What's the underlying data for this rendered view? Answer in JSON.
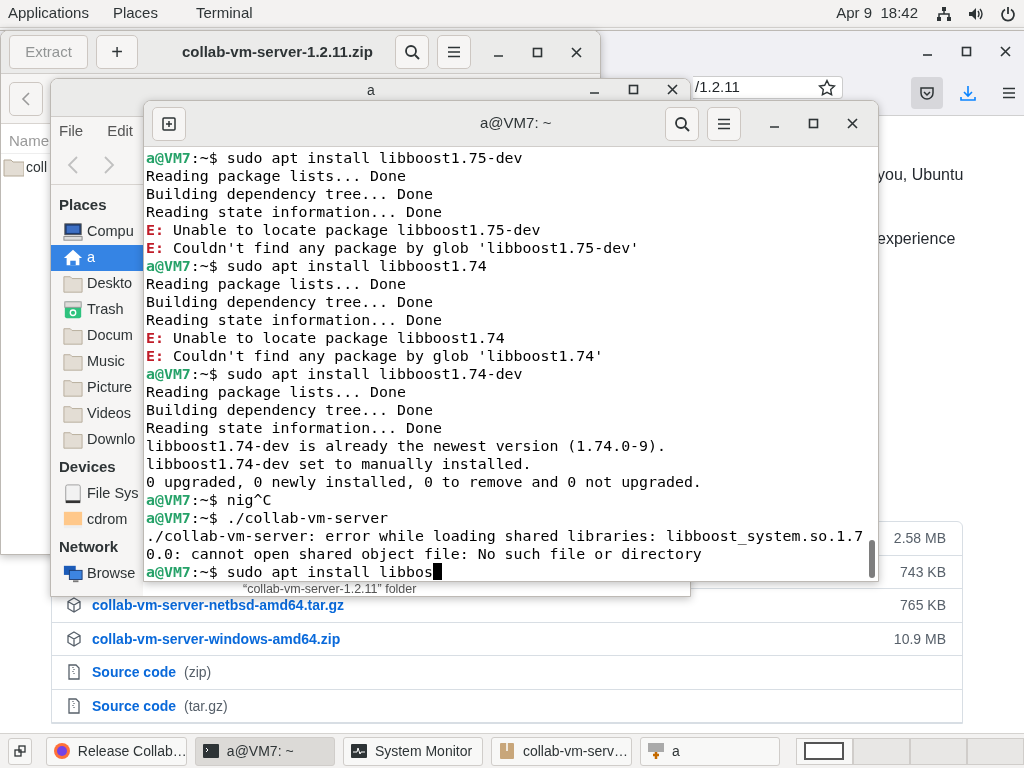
{
  "top_bar": {
    "menus": [
      "Applications",
      "Places",
      "Terminal"
    ],
    "clock": "Apr 9  18:42"
  },
  "browser": {
    "url": "/1.2.11",
    "text_lines": [
      "you, Ubuntu",
      "experience"
    ],
    "assets": [
      {
        "kind": "size_only",
        "size": "2.58 MB"
      },
      {
        "kind": "size_only",
        "size": "743 KB"
      },
      {
        "kind": "package",
        "name": "collab-vm-server-netbsd-amd64.tar.gz",
        "size": "765 KB"
      },
      {
        "kind": "package",
        "name": "collab-vm-server-windows-amd64.zip",
        "size": "10.9 MB"
      },
      {
        "kind": "source",
        "name": "Source code",
        "format": "(zip)"
      },
      {
        "kind": "source",
        "name": "Source code",
        "format": "(tar.gz)"
      }
    ]
  },
  "archive_window": {
    "extract_button": {
      "label": "Extract",
      "disabled": true
    },
    "add_button": "+",
    "title": "collab-vm-server-1.2.11.zip",
    "column": "Name",
    "rows": [
      "coll"
    ]
  },
  "file_manager": {
    "title": "a",
    "menus": [
      "File",
      "Edit"
    ],
    "sidebar": [
      {
        "heading": "Places",
        "items": [
          {
            "kind": "computer",
            "label": "Compu",
            "selected": false
          },
          {
            "kind": "home",
            "label": "a",
            "selected": true
          },
          {
            "kind": "folder",
            "label": "Deskto",
            "selected": false
          },
          {
            "kind": "trash",
            "label": "Trash",
            "selected": false
          },
          {
            "kind": "folder",
            "label": "Docum",
            "selected": false
          },
          {
            "kind": "folder",
            "label": "Music",
            "selected": false
          },
          {
            "kind": "folder",
            "label": "Picture",
            "selected": false
          },
          {
            "kind": "folder",
            "label": "Videos",
            "selected": false
          },
          {
            "kind": "folder",
            "label": "Downlo",
            "selected": false
          }
        ]
      },
      {
        "heading": "Devices",
        "items": [
          {
            "kind": "drive",
            "label": "File Sys",
            "selected": false
          },
          {
            "kind": "disc",
            "label": "cdrom",
            "selected": false
          }
        ]
      },
      {
        "heading": "Network",
        "items": [
          {
            "kind": "network",
            "label": "Browse",
            "selected": false
          }
        ]
      }
    ],
    "status": "“collab-vm-server-1.2.11” folder"
  },
  "terminal": {
    "title": "a@VM7: ~",
    "lines": [
      {
        "kind": "prompt",
        "user": "a@VM7",
        "path": ":~$",
        "command": "sudo apt install libboost1.75-dev"
      },
      {
        "kind": "output",
        "text": "Reading package lists... Done"
      },
      {
        "kind": "output",
        "text": "Building dependency tree... Done"
      },
      {
        "kind": "output",
        "text": "Reading state information... Done"
      },
      {
        "kind": "error",
        "label": "E:",
        "text": "Unable to locate package libboost1.75-dev"
      },
      {
        "kind": "error",
        "label": "E:",
        "text": "Couldn't find any package by glob 'libboost1.75-dev'"
      },
      {
        "kind": "prompt",
        "user": "a@VM7",
        "path": ":~$",
        "command": "sudo apt install libboost1.74"
      },
      {
        "kind": "output",
        "text": "Reading package lists... Done"
      },
      {
        "kind": "output",
        "text": "Building dependency tree... Done"
      },
      {
        "kind": "output",
        "text": "Reading state information... Done"
      },
      {
        "kind": "error",
        "label": "E:",
        "text": "Unable to locate package libboost1.74"
      },
      {
        "kind": "error",
        "label": "E:",
        "text": "Couldn't find any package by glob 'libboost1.74'"
      },
      {
        "kind": "prompt",
        "user": "a@VM7",
        "path": ":~$",
        "command": "sudo apt install libboost1.74-dev"
      },
      {
        "kind": "output",
        "text": "Reading package lists... Done"
      },
      {
        "kind": "output",
        "text": "Building dependency tree... Done"
      },
      {
        "kind": "output",
        "text": "Reading state information... Done"
      },
      {
        "kind": "output",
        "text": "libboost1.74-dev is already the newest version (1.74.0-9)."
      },
      {
        "kind": "output",
        "text": "libboost1.74-dev set to manually installed."
      },
      {
        "kind": "output",
        "text": "0 upgraded, 0 newly installed, 0 to remove and 0 not upgraded."
      },
      {
        "kind": "prompt",
        "user": "a@VM7",
        "path": ":~$",
        "command": "nig^C"
      },
      {
        "kind": "prompt",
        "user": "a@VM7",
        "path": ":~$",
        "command": "./collab-vm-server"
      },
      {
        "kind": "output",
        "text": "./collab-vm-server: error while loading shared libraries: libboost_system.so.1.7"
      },
      {
        "kind": "output",
        "text": "0.0: cannot open shared object file: No such file or directory"
      },
      {
        "kind": "prompt",
        "user": "a@VM7",
        "path": ":~$",
        "command": "sudo apt install libbos",
        "cursor": true
      }
    ]
  },
  "taskbar": {
    "tasks": [
      {
        "kind": "browser",
        "label": "Release Collab…",
        "selected": false
      },
      {
        "kind": "terminal",
        "label": "a@VM7: ~",
        "selected": true
      },
      {
        "kind": "monitor",
        "label": "System Monitor",
        "selected": false
      },
      {
        "kind": "archive",
        "label": "collab-vm-serv…",
        "selected": false
      },
      {
        "kind": "files",
        "label": "a",
        "selected": false
      }
    ],
    "workspaces": [
      {
        "selected": true
      },
      {
        "selected": false
      },
      {
        "selected": false
      },
      {
        "selected": false
      }
    ]
  }
}
